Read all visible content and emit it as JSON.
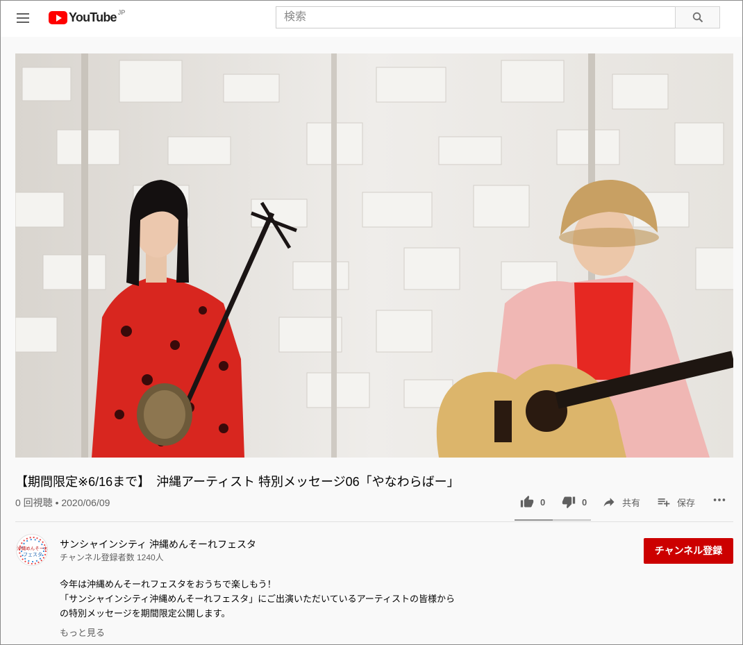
{
  "header": {
    "logo_text": "YouTube",
    "logo_region": "JP",
    "search_placeholder": "検索"
  },
  "video": {
    "title": "【期間限定※6/16まで】　沖縄アーティスト 特別メッセージ06「やなわらばー」",
    "views_date": "0 回視聴 • 2020/06/09",
    "like_count": "0",
    "dislike_count": "0",
    "share_label": "共有",
    "save_label": "保存",
    "like_ratio": 0.5
  },
  "channel": {
    "name": "サンシャインシティ 沖縄めんそーれフェスタ",
    "subscribers": "チャンネル登録者数 1240人",
    "subscribe_label": "チャンネル登録",
    "avatar_text_top": "沖縄めんそーれ",
    "avatar_text_bottom": "フェスタ"
  },
  "description": {
    "lines": [
      "今年は沖縄めんそーれフェスタをおうちで楽しもう！",
      "「サンシャインシティ沖縄めんそーれフェスタ」にご出演いただいているアーティストの皆様から",
      "の特別メッセージを期間限定公開します。"
    ],
    "more_label": "もっと見る"
  },
  "colors": {
    "brand_red": "#ff0000",
    "subscribe_red": "#cc0000"
  }
}
